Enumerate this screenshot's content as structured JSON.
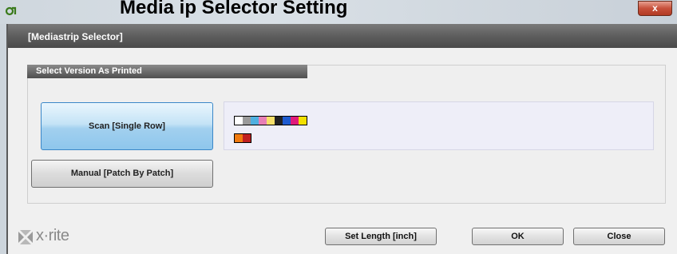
{
  "window": {
    "title_overflow": "Media      ip Selector Setting",
    "close_label": "x"
  },
  "header": {
    "title": "[Mediastrip Selector]"
  },
  "group": {
    "title": "Select Version As Printed"
  },
  "buttons": {
    "scan_label": "Scan [Single Row]",
    "manual_label": "Manual [Patch By Patch]",
    "set_length_label": "Set Length [inch]",
    "ok_label": "OK",
    "close_label": "Close"
  },
  "strip_preview": {
    "row1_colors": [
      "#ffffff",
      "#9a9a9a",
      "#4fb0e0",
      "#e87fb6",
      "#f7e06a",
      "#222222",
      "#1e5bd0",
      "#e01a7a",
      "#f2e000"
    ],
    "row2_colors": [
      "#f07a10",
      "#c02020"
    ]
  },
  "brand": {
    "logo_text": "x·rite"
  },
  "colors": {
    "header_bar": "#5e5e5e",
    "scan_button": "#a2d0ef",
    "close_button": "#c7503a"
  }
}
